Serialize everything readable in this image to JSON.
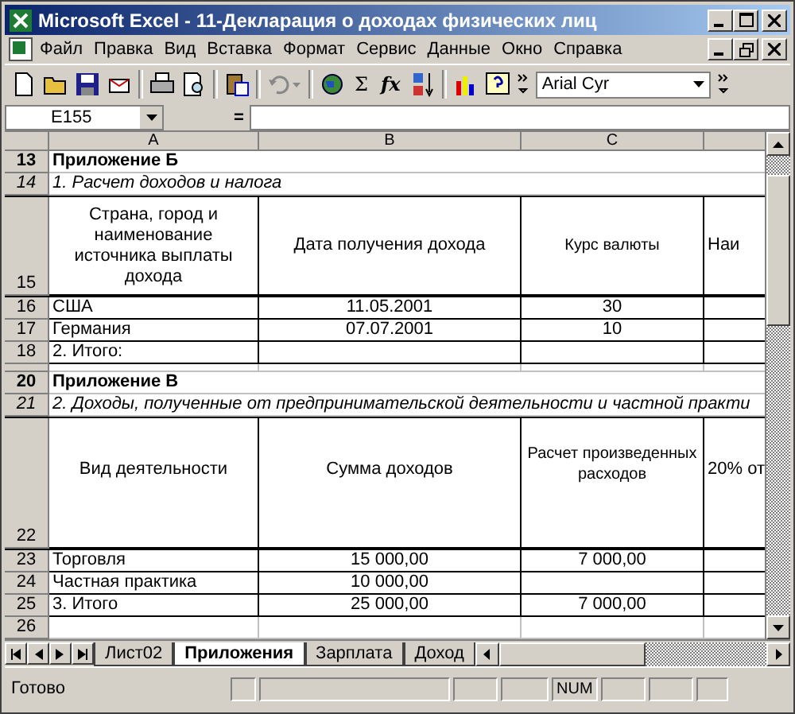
{
  "window": {
    "title": "Microsoft Excel - 11-Декларация о доходах физических лиц"
  },
  "menu": [
    "Файл",
    "Правка",
    "Вид",
    "Вставка",
    "Формат",
    "Сервис",
    "Данные",
    "Окно",
    "Справка"
  ],
  "toolbar": {
    "sum_label": "Σ",
    "function_label": "fx",
    "font": "Arial Cyr"
  },
  "formula_bar": {
    "name_box": "E155",
    "equals": "="
  },
  "columns": [
    "A",
    "B",
    "C"
  ],
  "rows": [
    {
      "number": "13",
      "kind": "bold",
      "cells": {
        "A": "Приложение Б"
      }
    },
    {
      "number": "14",
      "kind": "italic",
      "cells": {
        "A": "1. Расчет доходов и налога"
      }
    },
    {
      "number": "15",
      "kind": "header",
      "cells": {
        "A": "Страна, город и наименование источника выплаты дохода",
        "B": "Дата получения дохода",
        "C": "Курс валюты",
        "D": "Наи"
      }
    },
    {
      "number": "16",
      "kind": "data",
      "cells": {
        "A": "США",
        "B": "11.05.2001",
        "C": "30"
      }
    },
    {
      "number": "17",
      "kind": "data",
      "cells": {
        "A": "Германия",
        "B": "07.07.2001",
        "C": "10"
      }
    },
    {
      "number": "18",
      "kind": "data",
      "cells": {
        "A": "2. Итого:"
      }
    },
    {
      "kind": "sliver",
      "cells": {}
    },
    {
      "number": "20",
      "kind": "bold",
      "cells": {
        "A": "Приложение В"
      }
    },
    {
      "number": "21",
      "kind": "italic",
      "cells": {
        "A": "2. Доходы, полученные от предпринимательской деятельности и частной практи"
      }
    },
    {
      "number": "22",
      "kind": "tall_header",
      "cells": {
        "A": "Вид деятельности",
        "B": "Сумма доходов",
        "C": "Расчет произведенных расходов",
        "D": "20% от"
      }
    },
    {
      "number": "23",
      "kind": "data",
      "cells": {
        "A": "Торговля",
        "B": "15 000,00",
        "C": "7 000,00"
      }
    },
    {
      "number": "24",
      "kind": "data",
      "cells": {
        "A": "Частная практика",
        "B": "10 000,00"
      }
    },
    {
      "number": "25",
      "kind": "data",
      "cells": {
        "A": "3. Итого",
        "B": "25 000,00",
        "C": "7 000,00"
      }
    },
    {
      "number": "26",
      "kind": "blank",
      "cells": {}
    }
  ],
  "sheet_tabs": [
    {
      "label": "Лист02",
      "selected": false
    },
    {
      "label": "Приложения",
      "selected": true
    },
    {
      "label": "Зарплата",
      "selected": false
    },
    {
      "label": "Доход",
      "selected": false
    }
  ],
  "status_bar": {
    "message": "Готово",
    "indicator": "NUM"
  }
}
